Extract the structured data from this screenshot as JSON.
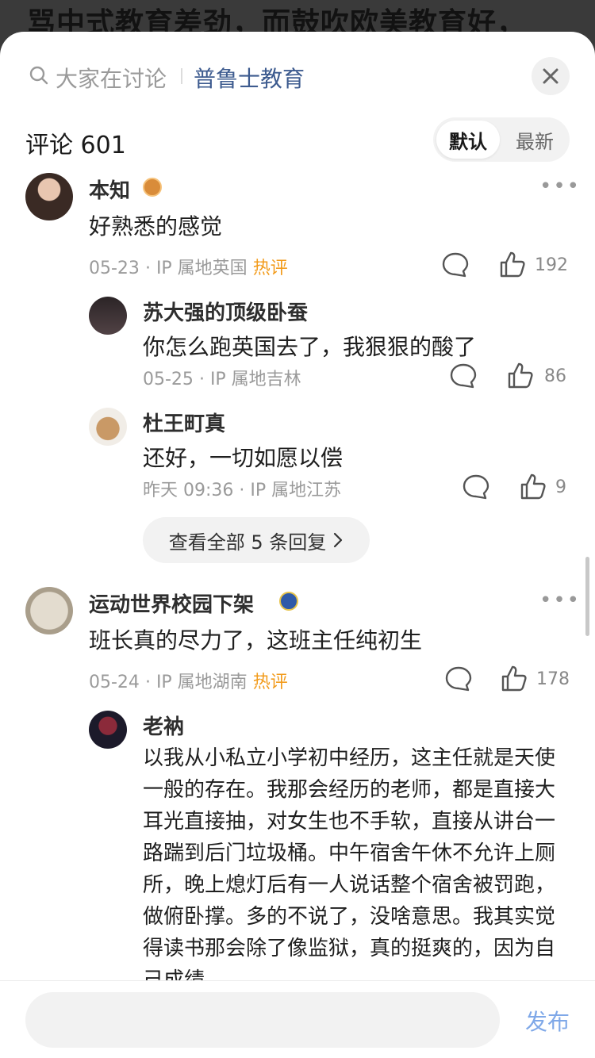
{
  "background": {
    "article_title_fragment": "骂中式教育差劲，而鼓吹欧美教育好，"
  },
  "topbar": {
    "search_hint": "大家在讨论",
    "topic": "普鲁士教育"
  },
  "comments_header": {
    "label": "评论 601"
  },
  "sort": {
    "default": "默认",
    "latest": "最新"
  },
  "comments": [
    {
      "user": "本知",
      "text": "好熟悉的感觉",
      "date": "05-23",
      "ip": "IP 属地英国",
      "hot": "热评",
      "likes": "192",
      "replies": [
        {
          "user": "苏大强的顶级卧蚕",
          "text": "你怎么跑英国去了，我狠狠的酸了",
          "date": "05-25",
          "ip": "IP 属地吉林",
          "likes": "86"
        },
        {
          "user": "杜王町真",
          "text": "还好，一切如愿以偿",
          "date": "昨天 09:36",
          "ip": "IP 属地江苏",
          "likes": "9"
        }
      ],
      "see_all": "查看全部 5 条回复"
    },
    {
      "user": "运动世界校园下架",
      "text": "班长真的尽力了，这班主任纯初生",
      "date": "05-24",
      "ip": "IP 属地湖南",
      "hot": "热评",
      "likes": "178",
      "replies": [
        {
          "user": "老衲",
          "text": "以我从小私立小学初中经历，这主任就是天使一般的存在。我那会经历的老师，都是直接大耳光直接抽，对女生也不手软，直接从讲台一路踹到后门垃圾桶。中午宿舍午休不允许上厕所，晚上熄灯后有一人说话整个宿舍被罚跑，做俯卧撑。多的不说了，没啥意思。我其实觉得读书那会除了像监狱，真的挺爽的，因为自己成绩"
        }
      ]
    }
  ],
  "sep": "·",
  "bottom": {
    "publish": "发布"
  },
  "colors": {
    "topic_blue": "#3d5b8f",
    "hot_orange": "#f29b1b",
    "publish_blue": "#7fa8e8"
  }
}
